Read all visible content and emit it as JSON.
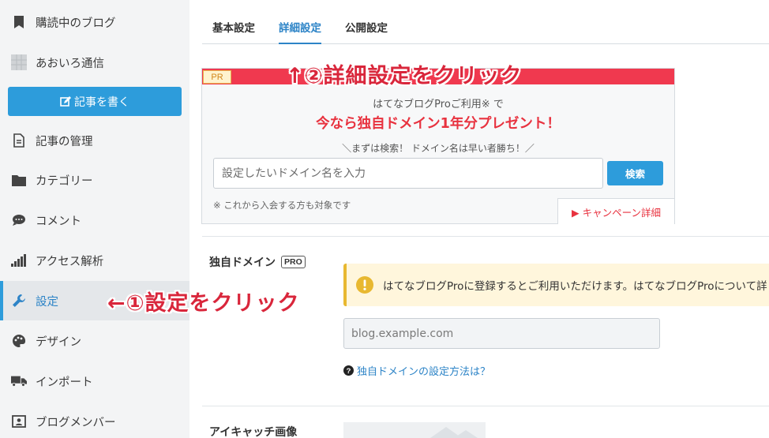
{
  "sidebar": {
    "items": [
      {
        "label": "購読中のブログ",
        "icon": "bookmark-icon"
      },
      {
        "label": "あおいろ通信",
        "icon": "blog-avatar"
      },
      {
        "label": "記事の管理",
        "icon": "document-icon"
      },
      {
        "label": "カテゴリー",
        "icon": "folder-icon"
      },
      {
        "label": "コメント",
        "icon": "comment-icon"
      },
      {
        "label": "アクセス解析",
        "icon": "signal-bars-icon"
      },
      {
        "label": "設定",
        "icon": "wrench-icon"
      },
      {
        "label": "デザイン",
        "icon": "palette-icon"
      },
      {
        "label": "インポート",
        "icon": "truck-icon"
      },
      {
        "label": "ブログメンバー",
        "icon": "id-card-icon"
      }
    ],
    "write_button": "記事を書く",
    "active_item": "設定"
  },
  "tabs": [
    {
      "label": "基本設定"
    },
    {
      "label": "詳細設定"
    },
    {
      "label": "公開設定"
    }
  ],
  "pr": {
    "tag": "PR",
    "line1": "はてなブログProご利用※ で",
    "line2": "今なら独自ドメイン1年分プレゼント！",
    "line3": "＼まずは検索！ ドメイン名は早い者勝ち！／",
    "search_placeholder": "設定したいドメイン名を入力",
    "search_button": "検索",
    "note": "※ これから入会する方も対象です",
    "campaign_link": "▶ キャンペーン詳細"
  },
  "custom_domain": {
    "label": "独自ドメイン",
    "badge": "PRO",
    "notice": "はてなブログProに登録するとご利用いただけます。はてなブログProについて詳しく",
    "placeholder": "blog.example.com",
    "help_link": "独自ドメインの設定方法は？"
  },
  "eyecatch": {
    "label": "アイキャッチ画像"
  },
  "annotations": {
    "step1": "←①設定をクリック",
    "step2": "↑②詳細設定をクリック"
  },
  "colors": {
    "accent": "#2d9cdb",
    "pr_red": "#f0394f",
    "annotation_red": "#d9263b",
    "notice_bg": "#fff6dc"
  }
}
